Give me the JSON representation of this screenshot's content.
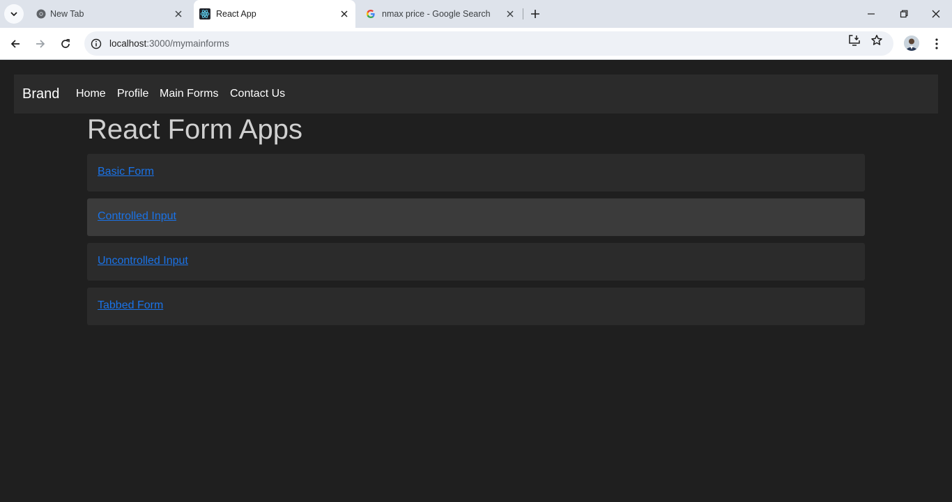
{
  "browser": {
    "tabs": [
      {
        "title": "New Tab",
        "icon": "chrome-icon",
        "active": false
      },
      {
        "title": "React App",
        "icon": "react-icon",
        "active": true
      },
      {
        "title": "nmax price - Google Search",
        "icon": "google-icon",
        "active": false
      }
    ],
    "url_host": "localhost",
    "url_path": ":3000/mymainforms"
  },
  "navbar": {
    "brand": "Brand",
    "links": [
      "Home",
      "Profile",
      "Main Forms",
      "Contact Us"
    ]
  },
  "main": {
    "heading": "React Form Apps",
    "items": [
      "Basic Form",
      "Controlled Input",
      "Uncontrolled Input",
      "Tabbed Form"
    ]
  },
  "colors": {
    "page_bg": "#1f1f1f",
    "navbar_bg": "#2b2b2b",
    "item_bg": "#2b2b2b",
    "item_hover_bg": "#3b3b3b",
    "link": "#1a73e8"
  }
}
